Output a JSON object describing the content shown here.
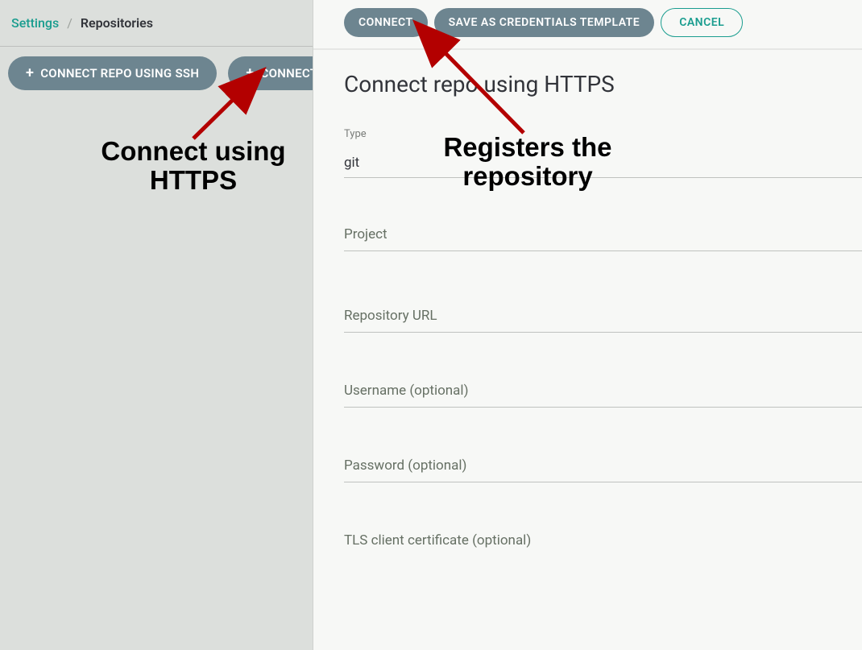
{
  "breadcrumb": {
    "settings": "Settings",
    "current": "Repositories",
    "sep": "/"
  },
  "bgActions": {
    "sshButton": "CONNECT REPO USING SSH",
    "httpsButton": "CONNECT"
  },
  "panel": {
    "actions": {
      "connect": "CONNECT",
      "saveTemplate": "SAVE AS CREDENTIALS TEMPLATE",
      "cancel": "CANCEL"
    },
    "title": "Connect repo using HTTPS",
    "type": {
      "label": "Type",
      "value": "git"
    },
    "fields": {
      "project": "Project",
      "repoUrl": "Repository URL",
      "username": "Username (optional)",
      "password": "Password (optional)",
      "tlsCert": "TLS client certificate (optional)"
    }
  },
  "annotations": {
    "left": "Connect using\nHTTPS",
    "right": "Registers the\nrepository"
  }
}
